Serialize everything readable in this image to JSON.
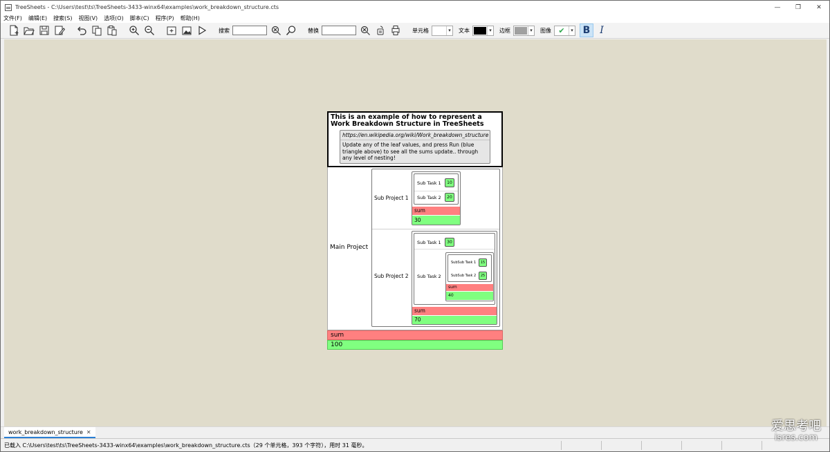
{
  "window": {
    "title": "TreeSheets - C:\\Users\\test\\ts\\TreeSheets-3433-winx64\\examples\\work_breakdown_structure.cts",
    "minimize": "—",
    "maximize": "❐",
    "close": "✕"
  },
  "menu": [
    "文件(F)",
    "编辑(E)",
    "搜索(S)",
    "视图(V)",
    "选项(O)",
    "脚本(C)",
    "程序(P)",
    "帮助(H)"
  ],
  "toolbar": {
    "search_label": "搜索",
    "search_value": "",
    "replace_label": "替换",
    "replace_value": "",
    "cell_label": "单元格",
    "text_label": "文本",
    "border_label": "边框",
    "image_label": "图像",
    "colors": {
      "cell": "#ffffff",
      "text": "#000000",
      "border": "#a0a0a0",
      "image_check": "#2fa84f"
    },
    "bold_glyph": "B",
    "italic_glyph": "I"
  },
  "document": {
    "title": "This is an example of how to represent a Work Breakdown Structure in TreeSheets",
    "link": "https://en.wikipedia.org/wiki/Work_breakdown_structure",
    "description": "Update any of the leaf values, and press Run (blue triangle above) to see all the sums update.. through any level of nesting!",
    "main_project": "Main Project",
    "sub_project_1": {
      "label": "Sub Project 1",
      "tasks": [
        {
          "name": "Sub Task 1",
          "value": "10"
        },
        {
          "name": "Sub Task 2",
          "value": "20"
        }
      ],
      "sum_label": "sum",
      "sum_value": "30"
    },
    "sub_project_2": {
      "label": "Sub Project 2",
      "task1": {
        "name": "Sub Task 1",
        "value": "30"
      },
      "task2": {
        "name": "Sub Task 2",
        "subtasks": [
          {
            "name": "SubSub Task 1",
            "value": "15"
          },
          {
            "name": "SubSub Task 2",
            "value": "25"
          }
        ],
        "sum_label": "sum",
        "sum_value": "40"
      },
      "sum_label": "sum",
      "sum_value": "70"
    },
    "total_label": "sum",
    "total_value": "100"
  },
  "tab": {
    "name": "work_breakdown_structure",
    "close": "✕"
  },
  "status": {
    "text": "已载入 C:\\Users\\test\\ts\\TreeSheets-3433-winx64\\examples\\work_breakdown_structure.cts（29 个单元格，393 个字符），用时 31 毫秒。"
  },
  "watermark": {
    "cn": "爱思考吧",
    "en": "isres.com"
  }
}
